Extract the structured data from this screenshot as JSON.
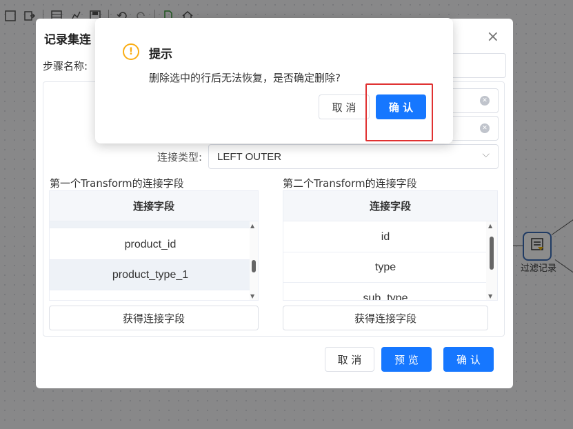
{
  "canvas": {
    "node_label": "过滤记录"
  },
  "dialog": {
    "title": "记录集连",
    "close": "×",
    "step_label": "步骤名称:",
    "join_type_label": "连接类型:",
    "join_type_value": "LEFT OUTER",
    "first_section": "第一个Transform的连接字段",
    "second_section": "第二个Transform的连接字段",
    "first_table": {
      "header": "连接字段",
      "rows": [
        "product_id",
        "product_type_1"
      ]
    },
    "second_table": {
      "header": "连接字段",
      "rows": [
        "id",
        "type",
        "sub_type"
      ]
    },
    "get_fields_1": "获得连接字段",
    "get_fields_2": "获得连接字段",
    "footer": {
      "cancel": "取 消",
      "preview": "预 览",
      "confirm": "确 认"
    }
  },
  "alert": {
    "icon": "!",
    "title": "提示",
    "message": "删除选中的行后无法恢复，是否确定删除?",
    "cancel": "取 消",
    "confirm": "确 认"
  },
  "colors": {
    "primary": "#1677ff",
    "warning": "#faad14",
    "highlight": "#e03131"
  }
}
